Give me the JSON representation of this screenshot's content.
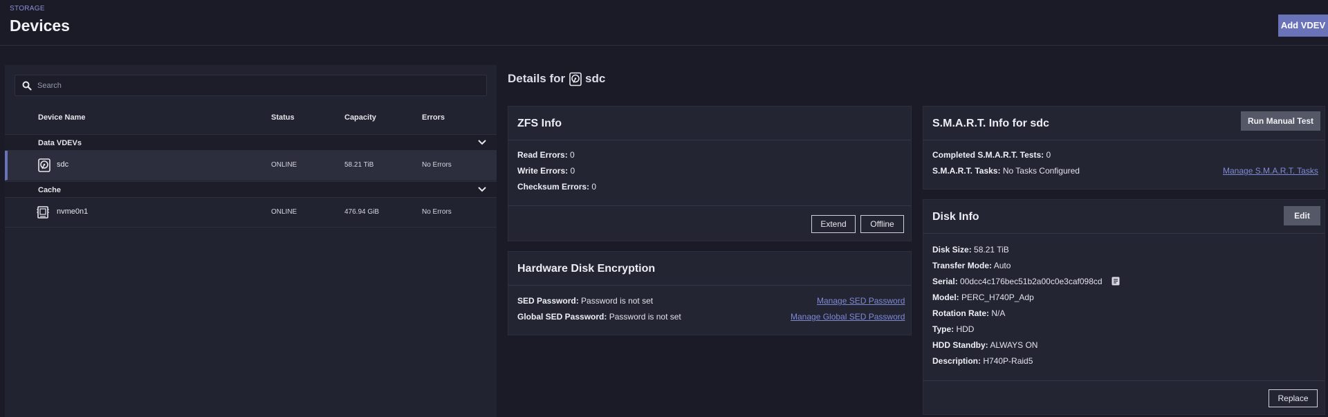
{
  "header": {
    "breadcrumb": "STORAGE",
    "title": "Devices",
    "add_vdev_label": "Add VDEV"
  },
  "search": {
    "placeholder": "Search"
  },
  "table": {
    "columns": [
      "Device Name",
      "Status",
      "Capacity",
      "Errors"
    ],
    "groups": [
      {
        "label": "Data VDEVs",
        "devices": [
          {
            "name": "sdc",
            "status": "ONLINE",
            "capacity": "58.21 TiB",
            "errors": "No Errors",
            "icon": "hdd-icon",
            "selected": true
          }
        ]
      },
      {
        "label": "Cache",
        "devices": [
          {
            "name": "nvme0n1",
            "status": "ONLINE",
            "capacity": "476.94 GiB",
            "errors": "No Errors",
            "icon": "ssd-icon",
            "selected": false
          }
        ]
      }
    ]
  },
  "details": {
    "prefix": "Details for",
    "disk": "sdc"
  },
  "zfs": {
    "title": "ZFS Info",
    "read_errors_label": "Read Errors:",
    "read_errors": "0",
    "write_errors_label": "Write Errors:",
    "write_errors": "0",
    "checksum_errors_label": "Checksum Errors:",
    "checksum_errors": "0",
    "extend_label": "Extend",
    "offline_label": "Offline"
  },
  "encryption": {
    "title": "Hardware Disk Encryption",
    "sed_label": "SED Password:",
    "sed_value": "Password is not set",
    "global_sed_label": "Global SED Password:",
    "global_sed_value": "Password is not set",
    "manage_sed_link": "Manage SED Password",
    "manage_global_sed_link": "Manage Global SED Password"
  },
  "smart": {
    "title": "S.M.A.R.T. Info for sdc",
    "run_test_label": "Run Manual Test",
    "completed_label": "Completed S.M.A.R.T. Tests:",
    "completed_value": "0",
    "tasks_label": "S.M.A.R.T. Tasks:",
    "tasks_value": "No Tasks Configured",
    "manage_link": "Manage S.M.A.R.T. Tasks"
  },
  "disk_info": {
    "title": "Disk Info",
    "edit_label": "Edit",
    "replace_label": "Replace",
    "disk_size_label": "Disk Size:",
    "disk_size": "58.21 TiB",
    "transfer_mode_label": "Transfer Mode:",
    "transfer_mode": "Auto",
    "serial_label": "Serial:",
    "serial": "00dcc4c176bec51b2a00c0e3caf098cd",
    "model_label": "Model:",
    "model": "PERC_H740P_Adp",
    "rotation_label": "Rotation Rate:",
    "rotation": "N/A",
    "type_label": "Type:",
    "type": "HDD",
    "standby_label": "HDD Standby:",
    "standby": "ALWAYS ON",
    "description_label": "Description:",
    "description": "H740P-Raid5"
  },
  "colors": {
    "accent": "#6b73b8",
    "background": "#1a1b26",
    "card": "#242533",
    "link": "#7f8ad6"
  }
}
